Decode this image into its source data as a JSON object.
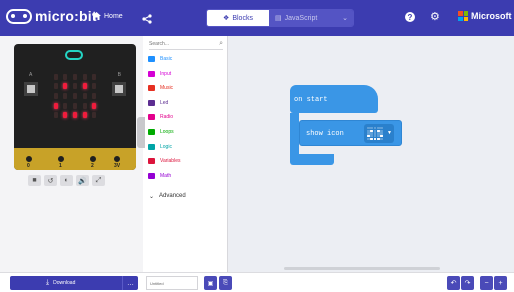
{
  "header": {
    "brand": "micro:bit",
    "home_label": "Home",
    "share_icon": "share-icon",
    "blocks_label": "Blocks",
    "javascript_label": "JavaScript",
    "help_glyph": "?",
    "settings_glyph": "⚙",
    "microsoft_label": "Microsoft",
    "colors": {
      "bar": "#3c3cb0",
      "accent": "#5454c4"
    }
  },
  "simulator": {
    "button_a": "A",
    "button_b": "B",
    "pins": [
      "0",
      "1",
      "2"
    ],
    "gnd_label": "GND",
    "volt_label": "3V",
    "led_pattern": [
      [
        0,
        0,
        0,
        0,
        0
      ],
      [
        0,
        1,
        0,
        1,
        0
      ],
      [
        0,
        0,
        0,
        0,
        0
      ],
      [
        1,
        0,
        0,
        0,
        1
      ],
      [
        0,
        1,
        1,
        1,
        0
      ]
    ],
    "controls": [
      "■",
      "↺",
      "◐",
      "🔊",
      "⤢"
    ]
  },
  "toolbox": {
    "search_placeholder": "Search...",
    "categories": [
      {
        "label": "Basic",
        "color": "#1e90ff"
      },
      {
        "label": "Input",
        "color": "#d400d4"
      },
      {
        "label": "Music",
        "color": "#e63022"
      },
      {
        "label": "Led",
        "color": "#5c2d91"
      },
      {
        "label": "Radio",
        "color": "#e3008c"
      },
      {
        "label": "Loops",
        "color": "#00aa00"
      },
      {
        "label": "Logic",
        "color": "#00a4a6"
      },
      {
        "label": "Variables",
        "color": "#dc143c"
      },
      {
        "label": "Math",
        "color": "#9400d3"
      }
    ],
    "advanced_label": "Advanced"
  },
  "workspace": {
    "on_start_label": "on start",
    "show_icon_label": "show icon",
    "icon_pattern": [
      [
        0,
        0,
        0,
        0,
        0
      ],
      [
        0,
        1,
        0,
        1,
        0
      ],
      [
        0,
        0,
        0,
        0,
        0
      ],
      [
        1,
        0,
        0,
        0,
        1
      ],
      [
        0,
        1,
        1,
        1,
        0
      ]
    ],
    "block_color": "#3a96e6"
  },
  "footer": {
    "download_label": "Download",
    "download_more": "…",
    "project_name": "Untitled",
    "save_glyph": "💾",
    "github_glyph": "⎘",
    "undo_glyph": "↶",
    "redo_glyph": "↷",
    "zoom_out_glyph": "−",
    "zoom_in_glyph": "+"
  }
}
